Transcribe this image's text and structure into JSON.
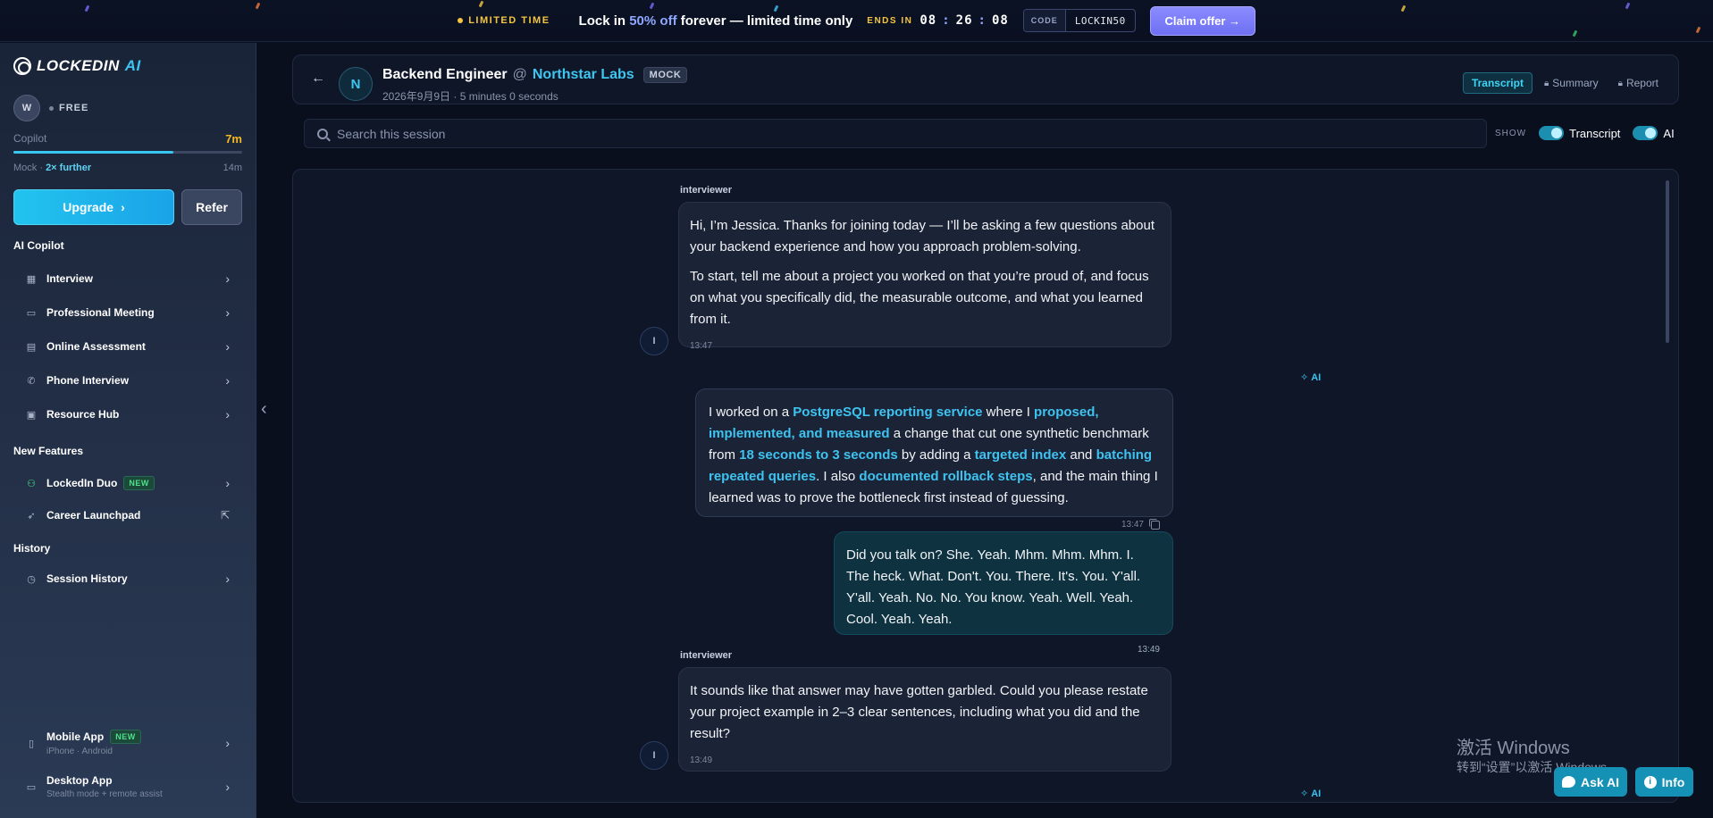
{
  "banner": {
    "limited_label": "LIMITED TIME",
    "lock_prefix": "Lock in",
    "percent": "50% off",
    "lock_suffix": "forever — limited time only",
    "ends_label": "ENDS IN",
    "timer_h": "08",
    "timer_m": "26",
    "timer_s": "08",
    "code_label": "CODE",
    "code_value": "LOCKIN50",
    "claim_label": "Claim offer →"
  },
  "sidebar": {
    "logo_main": "LOCKEDIN",
    "logo_ai": "AI",
    "avatar_initial": "W",
    "plan": "FREE",
    "copilot_label": "Copilot",
    "copilot_value": "7m",
    "copilot_progress": 0.7,
    "mock_label": "Mock ·",
    "mock_hl": "2× further",
    "mock_value": "14m",
    "upgrade_label": "Upgrade",
    "refer_label": "Refer",
    "sections": {
      "ai_copilot": "AI Copilot",
      "new_features": "New Features",
      "history": "History"
    },
    "copilot_items": [
      {
        "label": "Interview"
      },
      {
        "label": "Professional Meeting"
      },
      {
        "label": "Online Assessment"
      },
      {
        "label": "Phone Interview"
      },
      {
        "label": "Resource Hub"
      }
    ],
    "feature_items": [
      {
        "label": "LockedIn Duo",
        "badge": "NEW"
      },
      {
        "label": "Career Launchpad"
      }
    ],
    "history_items": [
      {
        "label": "Session History"
      }
    ],
    "apps": [
      {
        "title": "Mobile App",
        "badge": "NEW",
        "sub": "iPhone · Android"
      },
      {
        "title": "Desktop App",
        "sub": "Stealth mode + remote assist"
      }
    ]
  },
  "session": {
    "company_initial": "N",
    "role": "Backend Engineer",
    "at": "@",
    "company": "Northstar Labs",
    "badge": "MOCK",
    "subtitle": "2026年9月9日 · 5 minutes 0 seconds",
    "tabs": [
      {
        "label": "Transcript",
        "active": true
      },
      {
        "label": "Summary",
        "locked": true
      },
      {
        "label": "Report",
        "locked": true
      }
    ],
    "search_placeholder": "Search this session",
    "show_label": "SHOW",
    "toggle_transcript": "Transcript",
    "toggle_ai": "AI"
  },
  "messages": {
    "m1": {
      "speaker": "interviewer",
      "avatar": "I",
      "p1": "Hi, I’m Jessica. Thanks for joining today — I’ll be asking a few questions about your backend experience and how you approach problem-solving.",
      "p2": "To start, tell me about a project you worked on that you’re proud of, and focus on what you specifically did, the measurable outcome, and what you learned from it.",
      "time": "13:47"
    },
    "m2": {
      "tag": "AI",
      "t1": "I worked on a ",
      "h1": "PostgreSQL reporting service",
      "t2": " where I ",
      "h2": "proposed, implemented, and measured",
      "t3": " a change that cut one synthetic benchmark from ",
      "h3": "18 seconds to 3 seconds",
      "t4": " by adding a ",
      "h4": "targeted index",
      "t5": " and ",
      "h5": "batching repeated queries",
      "t6": ". I also ",
      "h6": "documented rollback steps",
      "t7": ", and the main thing I learned was to prove the bottleneck first instead of guessing.",
      "time": "13:47"
    },
    "m3": {
      "text": "Did you talk on? She. Yeah. Mhm. Mhm. Mhm. I. The heck. What. Don't. You. There. It's. You. Y'all. Y'all. Yeah. No. No. You know. Yeah. Well. Yeah. Cool. Yeah. Yeah.",
      "time": "13:49"
    },
    "m4": {
      "speaker": "interviewer",
      "avatar": "I",
      "text": "It sounds like that answer may have gotten garbled. Could you please restate your project example in 2–3 clear sentences, including what you did and the result?",
      "time": "13:49"
    },
    "m5_tag": "AI"
  },
  "overlay": {
    "watermark1": "激活 Windows",
    "watermark2": "转到“设置”以激活 Windows。",
    "ask_ai": "Ask AI",
    "info": "Info"
  }
}
